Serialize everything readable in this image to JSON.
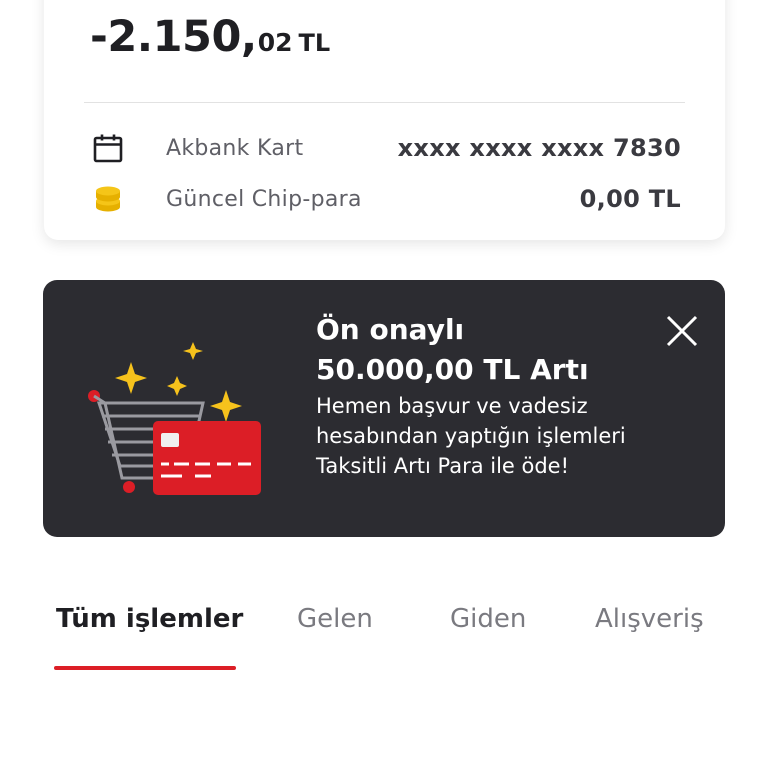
{
  "account": {
    "balance_main": "-2.150,",
    "balance_cents": "02",
    "balance_currency": "TL",
    "card_label": "Akbank Kart",
    "card_number": "xxxx xxxx xxxx 7830",
    "chip_label": "Güncel Chip-para",
    "chip_value": "0,00 TL",
    "icons": {
      "card": "calendar-icon",
      "chip": "coin-stack-icon"
    }
  },
  "promo": {
    "title_line1": "Ön onaylı",
    "title_line2": "50.000,00 TL Artı",
    "body": "Hemen başvur ve vadesiz hesabından yaptığın işlemleri Taksitli Artı Para ile öde!",
    "close_icon": "close-icon",
    "illustration": "shopping-cart-credit-card-illustration"
  },
  "tabs": [
    {
      "label": "Tüm işlemler",
      "active": true
    },
    {
      "label": "Gelen",
      "active": false
    },
    {
      "label": "Giden",
      "active": false
    },
    {
      "label": "Alışveriş",
      "active": false
    }
  ],
  "colors": {
    "accent_red": "#dc1e26",
    "banner_bg": "#2c2c31",
    "chip_yellow": "#f5c518",
    "sparkle_yellow": "#f6c21c"
  }
}
